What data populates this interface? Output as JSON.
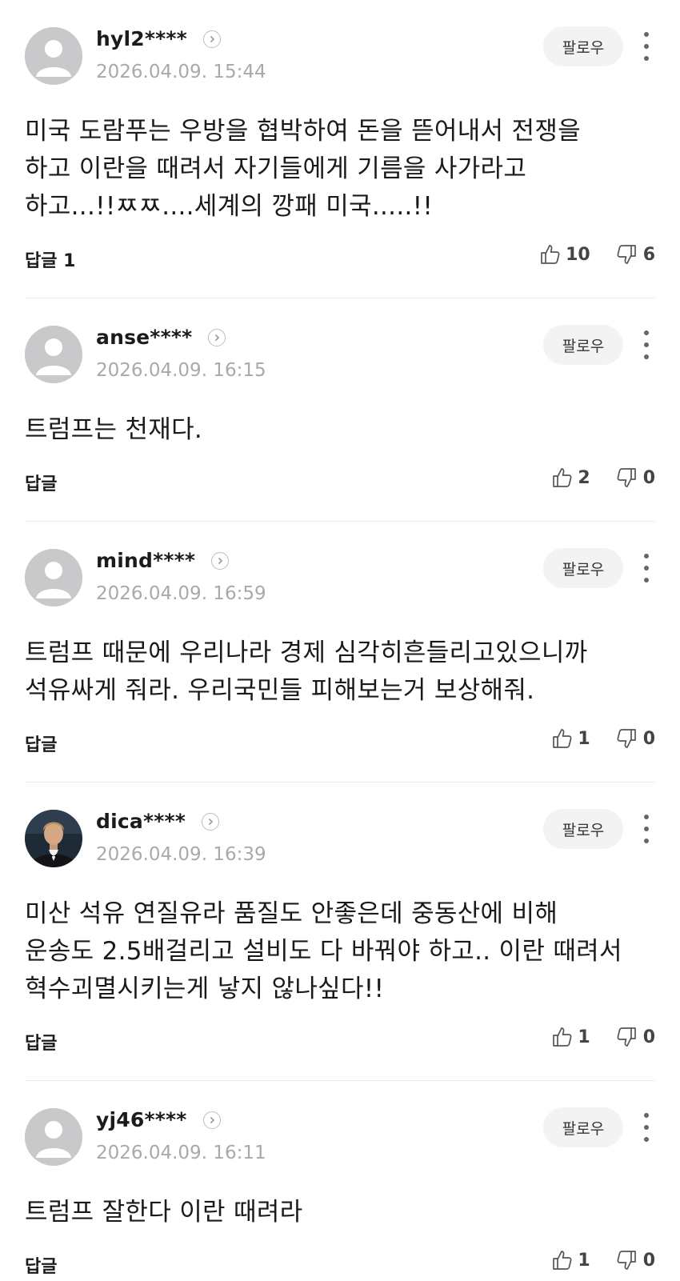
{
  "follow_label": "팔로우",
  "comments": [
    {
      "nick": "hyl2****",
      "date": "2026.04.09. 15:44",
      "body": "미국 도람푸는 우방을 협박하여 돈을 뜯어내서 전쟁을 하고 이란을 때려서 자기들에게 기름을 사가라고 하고...!!ㅉㅉ....세계의 깡패 미국.....!!",
      "reply": "답글 1",
      "likes": "10",
      "dislikes": "6",
      "avatar": "default-avatar"
    },
    {
      "nick": "anse****",
      "date": "2026.04.09. 16:15",
      "body": "트럼프는 천재다.",
      "reply": "답글",
      "likes": "2",
      "dislikes": "0",
      "avatar": "default-avatar"
    },
    {
      "nick": "mind****",
      "date": "2026.04.09. 16:59",
      "body": "트럼프 때문에 우리나라 경제 심각히흔들리고있으니까 석유싸게 줘라. 우리국민들 피해보는거 보상해줘.",
      "reply": "답글",
      "likes": "1",
      "dislikes": "0",
      "avatar": "default-avatar"
    },
    {
      "nick": "dica****",
      "date": "2026.04.09. 16:39",
      "body": "미산 석유 연질유라 품질도 안좋은데 중동산에 비해 운송도 2.5배걸리고 설비도 다 바꿔야 하고.. 이란 때려서 혁수괴멸시키는게 낳지 않나싶다!!",
      "reply": "답글",
      "likes": "1",
      "dislikes": "0",
      "avatar": "photo-avatar"
    },
    {
      "nick": "yj46****",
      "date": "2026.04.09. 16:11",
      "body": "트럼프 잘한다 이란 때려라",
      "reply": "답글",
      "likes": "1",
      "dislikes": "0",
      "avatar": "default-avatar"
    }
  ]
}
